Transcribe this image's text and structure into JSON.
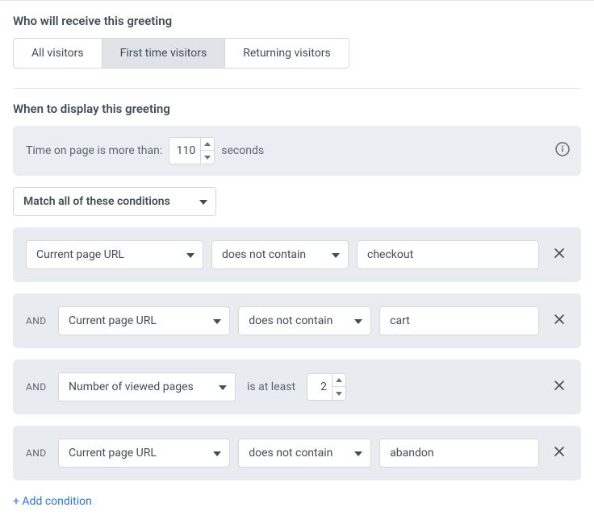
{
  "sections": {
    "who": {
      "title": "Who will receive this greeting",
      "tabs": [
        {
          "label": "All visitors",
          "active": false
        },
        {
          "label": "First time visitors",
          "active": true
        },
        {
          "label": "Returning visitors",
          "active": false
        }
      ]
    },
    "when": {
      "title": "When to display this greeting",
      "time_panel": {
        "prefix": "Time on page is more than:",
        "value": "110",
        "suffix": "seconds"
      },
      "match_mode": "Match all of these conditions",
      "join_label": "AND",
      "conditions": [
        {
          "show_join": false,
          "field": "Current page URL",
          "operator": "does not contain",
          "type": "text",
          "value": "checkout"
        },
        {
          "show_join": true,
          "field": "Current page URL",
          "operator": "does not contain",
          "type": "text",
          "value": "cart"
        },
        {
          "show_join": true,
          "field": "Number of viewed pages",
          "at_least_label": "is at least",
          "type": "number",
          "value": "2"
        },
        {
          "show_join": true,
          "field": "Current page URL",
          "operator": "does not contain",
          "type": "text",
          "value": "abandon"
        }
      ],
      "add_link": "+ Add condition"
    }
  },
  "icons": {
    "caret_down": "chevron-down-icon",
    "close": "close-icon",
    "info": "info-icon",
    "up": "chevron-up-icon",
    "down": "chevron-down-small-icon"
  }
}
